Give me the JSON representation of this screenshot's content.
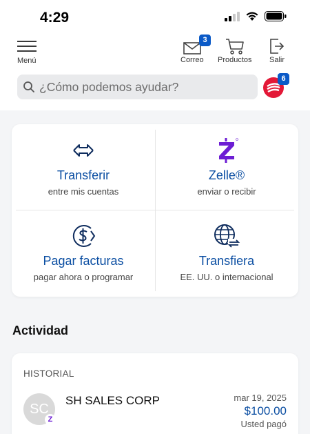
{
  "status_bar": {
    "time": "4:29",
    "icons": [
      "cellular-signal-icon",
      "wifi-icon",
      "battery-icon"
    ]
  },
  "header": {
    "menu_label": "Menú",
    "nav": [
      {
        "label": "Correo",
        "icon": "mail-icon",
        "badge": "3"
      },
      {
        "label": "Productos",
        "icon": "cart-icon"
      },
      {
        "label": "Salir",
        "icon": "logout-icon"
      }
    ],
    "brand_badge": "6"
  },
  "search": {
    "placeholder": "¿Cómo podemos ayudar?"
  },
  "actions": [
    {
      "title": "Transferir",
      "subtitle": "entre mis cuentas",
      "icon": "transfer-arrows-icon"
    },
    {
      "title": "Zelle®",
      "subtitle": "enviar o recibir",
      "icon": "zelle-icon"
    },
    {
      "title": "Pagar facturas",
      "subtitle": "pagar ahora o programar",
      "icon": "bill-pay-icon"
    },
    {
      "title": "Transfiera",
      "subtitle": "EE. UU. o internacional",
      "icon": "globe-transfer-icon"
    }
  ],
  "activity": {
    "title": "Actividad",
    "history_label": "HISTORIAL",
    "transactions": [
      {
        "avatar_initials": "SC",
        "avatar_badge": "Z",
        "name": "SH SALES CORP",
        "date": "mar 19, 2025",
        "amount": "$100.00",
        "note": "Usted pagó"
      }
    ]
  },
  "colors": {
    "primary_blue": "#0b4ea2",
    "badge_blue": "#0b5ac7",
    "brand_red": "#e31837",
    "zelle_purple": "#6d1ed4",
    "background": "#f4f5f7"
  }
}
